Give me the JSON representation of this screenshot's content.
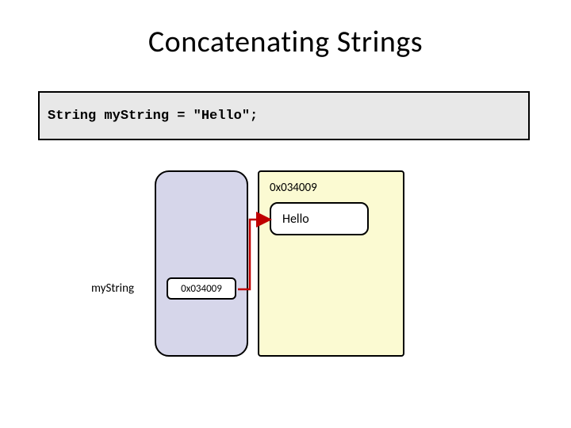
{
  "title": "Concatenating Strings",
  "code": "String myString = \"Hello\";",
  "stack": {
    "varName": "myString",
    "varValue": "0x034009"
  },
  "heap": {
    "address": "0x034009",
    "object": "Hello"
  }
}
